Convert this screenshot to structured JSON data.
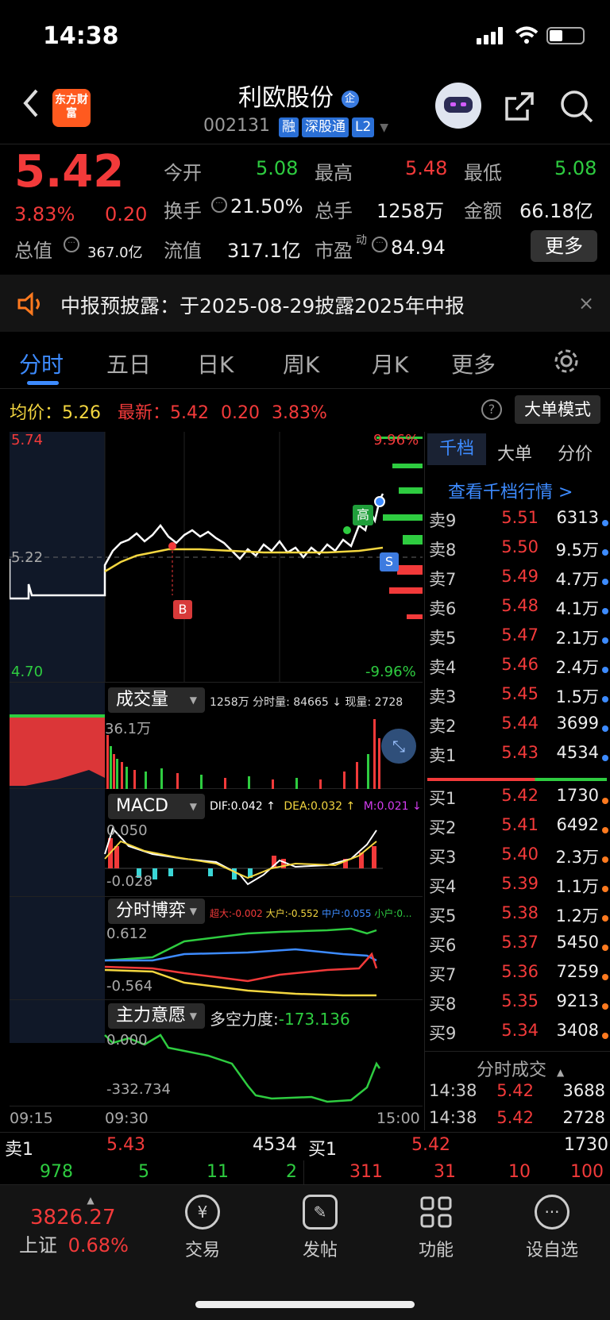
{
  "status_bar": {
    "time": "14:38"
  },
  "header": {
    "back_icon": "chevron-left-icon",
    "logo": "东方财富",
    "title": "利欧股份",
    "title_badge": "企",
    "code": "002131",
    "tags": [
      "融",
      "深股通",
      "L2"
    ],
    "robot_icon": "robot-avatar-icon",
    "share_icon": "share-icon",
    "search_icon": "search-icon"
  },
  "quote": {
    "price": "5.42",
    "change_pct": "3.83%",
    "change": "0.20",
    "open_label": "今开",
    "open": "5.08",
    "high_label": "最高",
    "high": "5.48",
    "low_label": "最低",
    "low": "5.08",
    "turnover_label": "换手",
    "turnover": "21.50%",
    "volume_label": "总手",
    "volume": "1258万",
    "amount_label": "金额",
    "amount": "66.18亿",
    "mktcap_label": "总值",
    "mktcap": "367.0亿",
    "float_label": "流值",
    "float": "317.1亿",
    "pe_label": "市盈",
    "pe_sup": "动",
    "pe": "84.94",
    "more_button": "更多"
  },
  "notice": {
    "text": "中报预披露：于2025-08-29披露2025年中报"
  },
  "tabs": [
    "分时",
    "五日",
    "日K",
    "周K",
    "月K",
    "更多"
  ],
  "info_line": {
    "avg_label": "均价：",
    "avg": "5.26",
    "latest_label": "最新：",
    "latest": "5.42",
    "chg": "0.20",
    "pct": "3.83%",
    "mode_button": "大单模式"
  },
  "price_chart": {
    "top_price": "5.74",
    "mid_price": "5.22",
    "bottom_price": "4.70",
    "top_pct": "9.96%",
    "bottom_pct": "-9.96%",
    "marker_high": "高",
    "marker_b": "B",
    "marker_s": "S"
  },
  "volume_panel": {
    "dropdown": "成交量",
    "info": "1258万 分时量: 84665 ↓ 现量: 2728",
    "max_label": "36.1万"
  },
  "macd_panel": {
    "dropdown": "MACD",
    "dif": "DIF:0.042 ↑",
    "dea": "DEA:0.032 ↑",
    "m": "M:0.021 ↓",
    "top": "0.050",
    "bottom": "-0.028"
  },
  "game_panel": {
    "dropdown": "分时博弈",
    "super": "超大:-0.002",
    "large": "大户:-0.552",
    "mid": "中户:0.055",
    "small": "小户:0...",
    "top": "0.612",
    "bottom": "-0.564"
  },
  "intent_panel": {
    "dropdown": "主力意愿",
    "label": "多空力度:",
    "value": "-173.136",
    "top": "0.000",
    "bottom": "-332.734"
  },
  "time_axis": [
    "09:15",
    "09:30",
    "15:00"
  ],
  "order_tabs": [
    "千档",
    "大单",
    "分价"
  ],
  "order_link": "查看千档行情 >",
  "asks": [
    {
      "name": "卖9",
      "price": "5.51",
      "vol": "6313"
    },
    {
      "name": "卖8",
      "price": "5.50",
      "vol": "9.5万"
    },
    {
      "name": "卖7",
      "price": "5.49",
      "vol": "4.7万"
    },
    {
      "name": "卖6",
      "price": "5.48",
      "vol": "4.1万"
    },
    {
      "name": "卖5",
      "price": "5.47",
      "vol": "2.1万"
    },
    {
      "name": "卖4",
      "price": "5.46",
      "vol": "2.4万"
    },
    {
      "name": "卖3",
      "price": "5.45",
      "vol": "1.5万"
    },
    {
      "name": "卖2",
      "price": "5.44",
      "vol": "3699"
    },
    {
      "name": "卖1",
      "price": "5.43",
      "vol": "4534"
    }
  ],
  "bids": [
    {
      "name": "买1",
      "price": "5.42",
      "vol": "1730"
    },
    {
      "name": "买2",
      "price": "5.41",
      "vol": "6492"
    },
    {
      "name": "买3",
      "price": "5.40",
      "vol": "2.3万"
    },
    {
      "name": "买4",
      "price": "5.39",
      "vol": "1.1万"
    },
    {
      "name": "买5",
      "price": "5.38",
      "vol": "1.2万"
    },
    {
      "name": "买6",
      "price": "5.37",
      "vol": "5450"
    },
    {
      "name": "买7",
      "price": "5.36",
      "vol": "7259"
    },
    {
      "name": "买8",
      "price": "5.35",
      "vol": "9213"
    },
    {
      "name": "买9",
      "price": "5.34",
      "vol": "3408"
    }
  ],
  "ticks_header": "分时成交",
  "ticks": [
    {
      "time": "14:38",
      "price": "5.42",
      "vol": "3688"
    },
    {
      "time": "14:38",
      "price": "5.42",
      "vol": "2728"
    }
  ],
  "summary": {
    "ask_label": "卖1",
    "ask_price": "5.43",
    "ask_vol": "4534",
    "bid_label": "买1",
    "bid_price": "5.42",
    "bid_vol": "1730",
    "left_counts": [
      "978",
      "5",
      "11",
      "2"
    ],
    "right_counts": [
      "311",
      "31",
      "10",
      "100"
    ]
  },
  "bottom_nav": {
    "index_value": "3826.27",
    "index_name": "上证",
    "index_pct": "0.68%",
    "items": [
      "交易",
      "发帖",
      "功能",
      "设自选"
    ]
  }
}
